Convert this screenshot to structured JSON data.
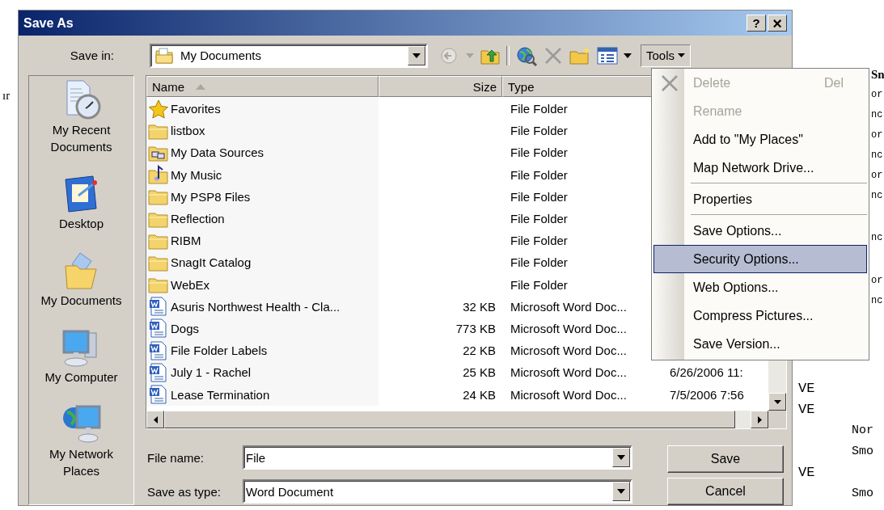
{
  "background_document": {
    "left_fragment": "ır",
    "blocks": [
      {
        "lines": [
          {
            "text": "Sn",
            "kind": "heading"
          },
          {
            "text": "or",
            "kind": "tail"
          },
          {
            "text": "nc",
            "kind": "tail"
          },
          {
            "text": "or",
            "kind": "tail"
          },
          {
            "text": "nc",
            "kind": "tail"
          },
          {
            "text": "or",
            "kind": "tail"
          },
          {
            "text": "nc",
            "kind": "tail"
          }
        ]
      },
      {
        "lines": [
          {
            "text": "nc",
            "kind": "tail"
          }
        ]
      },
      {
        "lines": [
          {
            "text": "or",
            "kind": "tail"
          },
          {
            "text": "nc",
            "kind": "tail"
          }
        ]
      },
      {
        "lines": [
          {
            "text": "VE",
            "kind": "left"
          },
          {
            "text": "VE",
            "kind": "left"
          },
          {
            "text": "Nor",
            "kind": "mid"
          },
          {
            "text": "Smo",
            "kind": "mid"
          },
          {
            "text": "VE",
            "kind": "left"
          },
          {
            "text": "Smo",
            "kind": "mid"
          }
        ]
      }
    ]
  },
  "window": {
    "title": "Save As",
    "help_button": "?",
    "close_button": "×"
  },
  "save_in": {
    "label": "Save in:",
    "value": "My Documents"
  },
  "toolbar": {
    "back_disabled": true,
    "tools": {
      "label": "Tools",
      "open": true
    }
  },
  "places": [
    {
      "label": "My Recent Documents",
      "kind": "recent"
    },
    {
      "label": "Desktop",
      "kind": "desktop"
    },
    {
      "label": "My Documents",
      "kind": "documents"
    },
    {
      "label": "My Computer",
      "kind": "computer"
    },
    {
      "label": "My Network Places",
      "kind": "network"
    }
  ],
  "file_list": {
    "columns": [
      "Name",
      "Size",
      "Type"
    ],
    "rows": [
      {
        "name": "Favorites",
        "type": "File Folder",
        "kind": "star"
      },
      {
        "name": "listbox",
        "type": "File Folder",
        "kind": "folder"
      },
      {
        "name": "My Data Sources",
        "type": "File Folder",
        "kind": "data"
      },
      {
        "name": "My Music",
        "type": "File Folder",
        "kind": "music"
      },
      {
        "name": "My PSP8 Files",
        "type": "File Folder",
        "kind": "folder"
      },
      {
        "name": "Reflection",
        "type": "File Folder",
        "kind": "folder"
      },
      {
        "name": "RIBM",
        "type": "File Folder",
        "kind": "folder"
      },
      {
        "name": "SnagIt Catalog",
        "type": "File Folder",
        "kind": "folder"
      },
      {
        "name": "WebEx",
        "type": "File Folder",
        "kind": "folder"
      },
      {
        "name": "Asuris Northwest Health - Cla...",
        "size": "32 KB",
        "type": "Microsoft Word Doc...",
        "kind": "doc"
      },
      {
        "name": "Dogs",
        "size": "773 KB",
        "type": "Microsoft Word Doc...",
        "kind": "doc"
      },
      {
        "name": "File Folder Labels",
        "size": "22 KB",
        "type": "Microsoft Word Doc...",
        "kind": "doc"
      },
      {
        "name": "July 1 - Rachel",
        "size": "25 KB",
        "type": "Microsoft Word Doc...",
        "date": "6/26/2006 11:",
        "kind": "doc"
      },
      {
        "name": "Lease Termination",
        "size": "24 KB",
        "type": "Microsoft Word Doc...",
        "date": "7/5/2006 7:56",
        "kind": "doc"
      }
    ]
  },
  "tools_menu": [
    {
      "kind": "icon-item",
      "label": "Delete",
      "shortcut": "Del",
      "disabled": true,
      "selected": false
    },
    {
      "kind": "item",
      "label": "Rename",
      "disabled": true,
      "selected": false
    },
    {
      "kind": "item",
      "label": "Add to \"My Places\"",
      "disabled": false,
      "selected": false
    },
    {
      "kind": "item",
      "label": "Map Network Drive...",
      "disabled": false,
      "selected": false
    },
    {
      "kind": "separator"
    },
    {
      "kind": "item",
      "label": "Properties",
      "disabled": false,
      "selected": false
    },
    {
      "kind": "separator"
    },
    {
      "kind": "item",
      "label": "Save Options...",
      "disabled": false,
      "selected": false
    },
    {
      "kind": "item",
      "label": "Security Options...",
      "disabled": false,
      "selected": true
    },
    {
      "kind": "item",
      "label": "Web Options...",
      "disabled": false,
      "selected": false
    },
    {
      "kind": "item",
      "label": "Compress Pictures...",
      "disabled": false,
      "selected": false
    },
    {
      "kind": "item",
      "label": "Save Version...",
      "disabled": false,
      "selected": false
    }
  ],
  "file_name": {
    "label": "File name:",
    "value": "File"
  },
  "save_as_type": {
    "label": "Save as type:",
    "value": "Word Document"
  },
  "buttons": [
    "Save",
    "Cancel"
  ]
}
